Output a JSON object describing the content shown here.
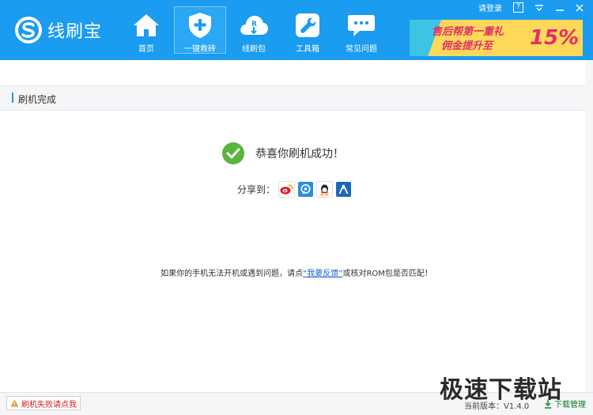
{
  "app": {
    "name": "线刷宝"
  },
  "topbar": {
    "login": "请登录",
    "help": "?"
  },
  "nav": [
    {
      "label": "首页",
      "icon": "home-icon"
    },
    {
      "label": "一键救砖",
      "icon": "shield-plus-icon"
    },
    {
      "label": "线刷包",
      "icon": "cloud-download-icon"
    },
    {
      "label": "工具箱",
      "icon": "wrench-icon"
    },
    {
      "label": "常见问题",
      "icon": "chat-bubble-icon"
    }
  ],
  "banner": {
    "line1": "售后帮第一重礼",
    "line2": "佣金提升至",
    "percent": "15%"
  },
  "section": {
    "title": "刷机完成"
  },
  "result": {
    "message": "恭喜你刷机成功！"
  },
  "share": {
    "label": "分享到：",
    "targets": [
      "weibo-icon",
      "tencent-weibo-icon",
      "qq-icon",
      "renren-icon"
    ]
  },
  "notice": {
    "before": "如果你的手机无法开机或遇到问题，请点",
    "link": "“我要反馈”",
    "after": "或核对ROM包是否匹配！"
  },
  "footer": {
    "fail_label": "刷机失败请点我",
    "version": "当前版本：V1.4.0",
    "download": "下载管理",
    "watermark": "极速下载站"
  },
  "colors": {
    "primary": "#1a9cf0",
    "success": "#5ab53c",
    "link": "#1a5fd0",
    "warning": "#d42020"
  }
}
